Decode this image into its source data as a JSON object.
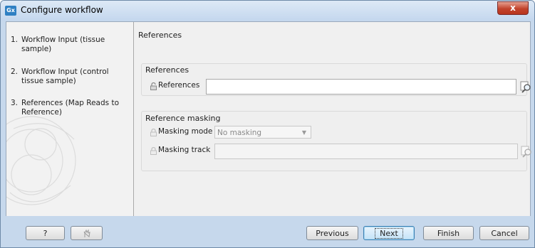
{
  "window": {
    "title": "Configure workflow",
    "icon_name": "gx-app-icon",
    "close_glyph": "x"
  },
  "sidebar": {
    "steps": [
      {
        "number": "1.",
        "label": "Workflow Input (tissue sample)"
      },
      {
        "number": "2.",
        "label": "Workflow Input (control tissue sample)"
      },
      {
        "number": "3.",
        "label": "References (Map Reads to Reference)"
      }
    ]
  },
  "main": {
    "page_title": "References",
    "references_group": {
      "title": "References",
      "field_label": "References",
      "value": ""
    },
    "masking_group": {
      "title": "Reference masking",
      "mode_label": "Masking mode",
      "mode_value": "No masking",
      "track_label": "Masking track",
      "track_value": ""
    }
  },
  "buttons": {
    "help": "?",
    "previous": "Previous",
    "next": "Next",
    "finish": "Finish",
    "cancel": "Cancel"
  },
  "colors": {
    "frame": "#c6d8ec",
    "accent": "#3c7fb1",
    "close": "#c2432c"
  }
}
